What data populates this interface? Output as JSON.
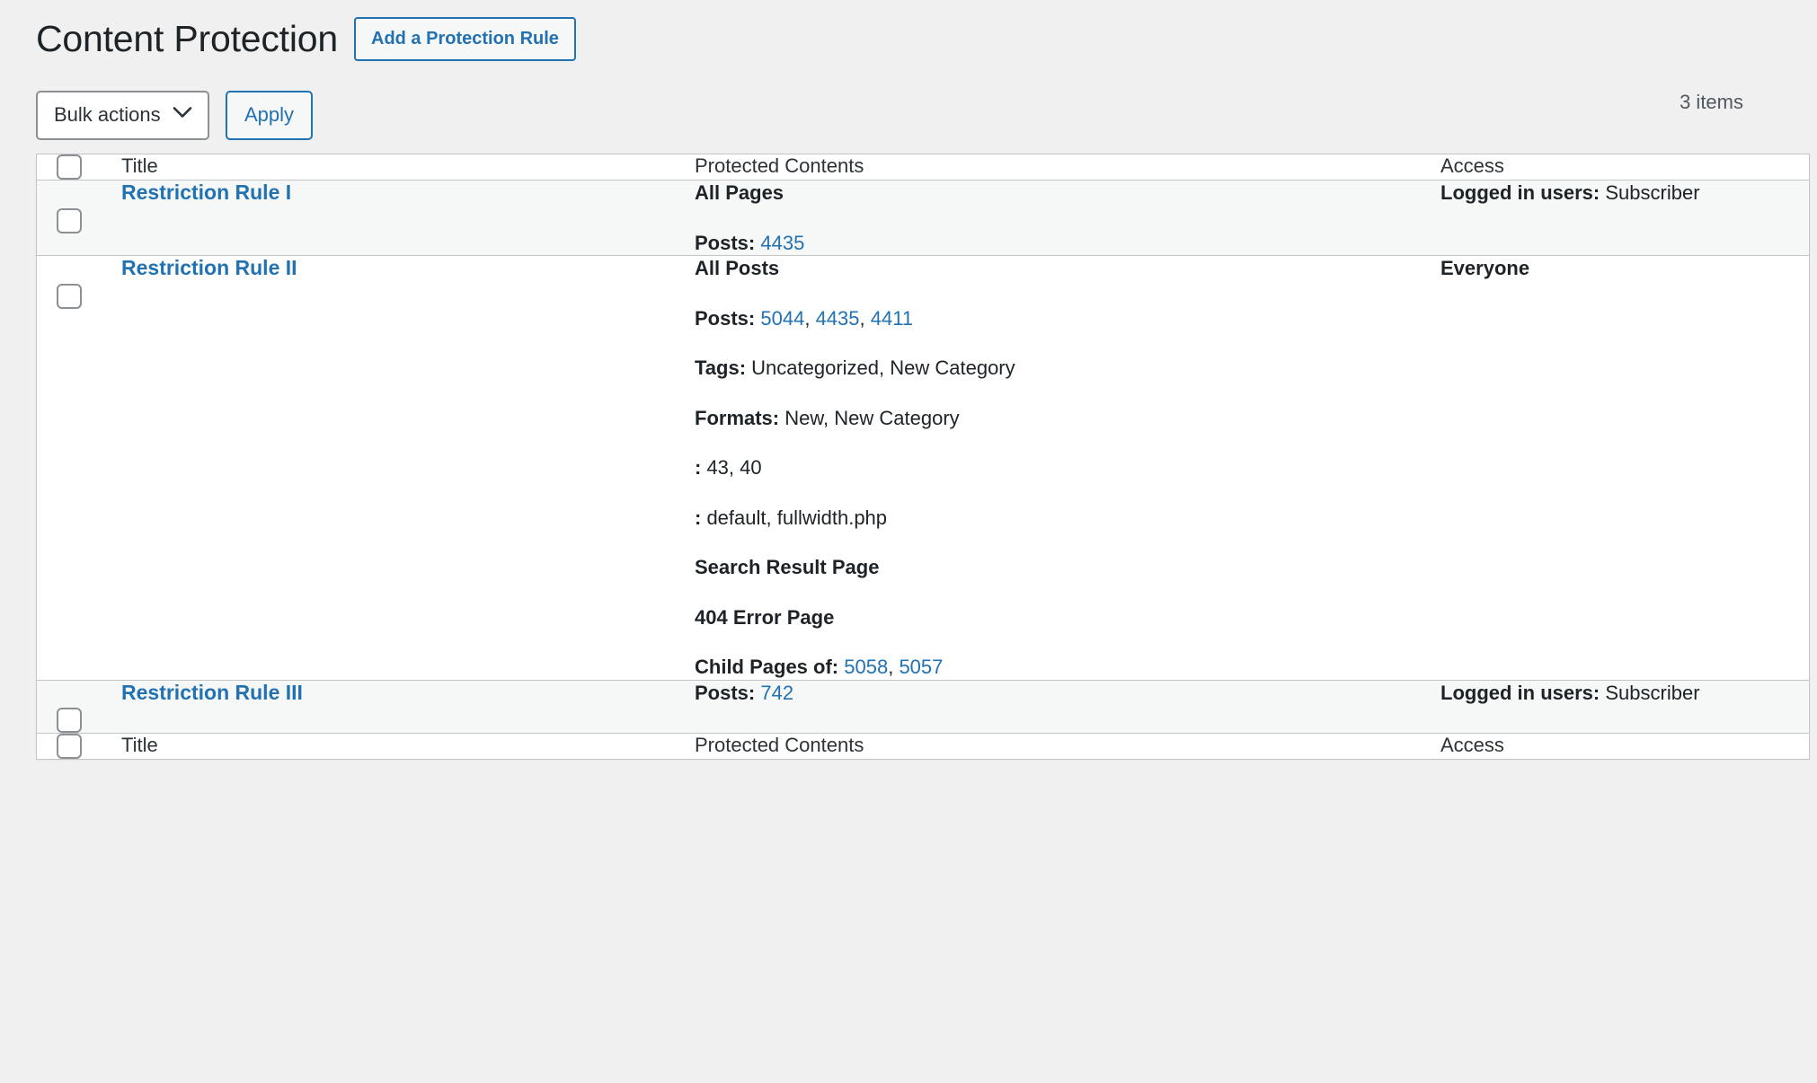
{
  "header": {
    "title": "Content Protection",
    "add_rule_label": "Add a Protection Rule"
  },
  "toolbar": {
    "bulk_actions_label": "Bulk actions",
    "bulk_actions_options": [
      "Bulk actions"
    ],
    "apply_label": "Apply",
    "displaying_num": "3 items",
    "chevron_icon": "chevron-down-icon"
  },
  "table": {
    "columns": {
      "title": "Title",
      "protected_contents": "Protected Contents",
      "access": "Access"
    },
    "rows": [
      {
        "title": "Restriction Rule I",
        "contents": [
          {
            "label": "All Pages",
            "label_bold": true,
            "value": "",
            "links": []
          },
          {
            "label": "Posts:",
            "label_bold": true,
            "value": "",
            "links": [
              "4435"
            ]
          }
        ],
        "access_label": "Logged in users:",
        "access_value": "Subscriber"
      },
      {
        "title": "Restriction Rule II",
        "contents": [
          {
            "label": "All Posts",
            "label_bold": true,
            "value": "",
            "links": []
          },
          {
            "label": "Posts:",
            "label_bold": true,
            "value": "",
            "links": [
              "5044",
              "4435",
              "4411"
            ]
          },
          {
            "label": "Tags:",
            "label_bold": true,
            "value": "Uncategorized, New Category",
            "links": []
          },
          {
            "label": "Formats:",
            "label_bold": true,
            "value": "New, New Category",
            "links": []
          },
          {
            "label": ":",
            "label_bold": true,
            "value": "43, 40",
            "links": []
          },
          {
            "label": ":",
            "label_bold": true,
            "value": "default, fullwidth.php",
            "links": []
          },
          {
            "label": "Search Result Page",
            "label_bold": true,
            "value": "",
            "links": []
          },
          {
            "label": "404 Error Page",
            "label_bold": true,
            "value": "",
            "links": []
          },
          {
            "label": "Child Pages of:",
            "label_bold": true,
            "value": "",
            "links": [
              "5058",
              "5057"
            ]
          }
        ],
        "access_label": "Everyone",
        "access_value": ""
      },
      {
        "title": "Restriction Rule III",
        "contents": [
          {
            "label": "Posts:",
            "label_bold": true,
            "value": "",
            "links": [
              "742"
            ]
          }
        ],
        "access_label": "Logged in users:",
        "access_value": "Subscriber"
      }
    ]
  },
  "colors": {
    "link": "#2271b1",
    "page_bg": "#f0f0f1",
    "row_alt_bg": "#f6f7f7",
    "border": "#c3c4c7",
    "text": "#1d2327"
  }
}
